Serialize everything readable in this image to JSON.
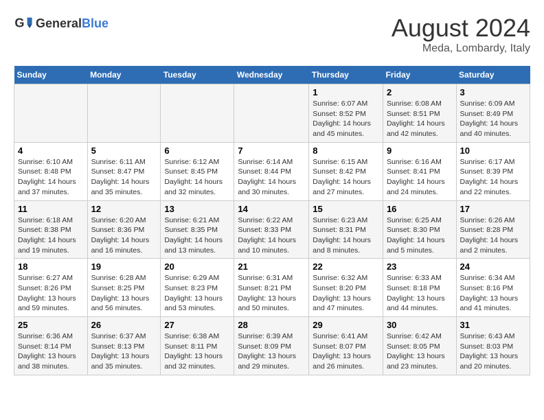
{
  "header": {
    "logo_general": "General",
    "logo_blue": "Blue",
    "main_title": "August 2024",
    "subtitle": "Meda, Lombardy, Italy"
  },
  "weekdays": [
    "Sunday",
    "Monday",
    "Tuesday",
    "Wednesday",
    "Thursday",
    "Friday",
    "Saturday"
  ],
  "weeks": [
    [
      {
        "day": "",
        "info": ""
      },
      {
        "day": "",
        "info": ""
      },
      {
        "day": "",
        "info": ""
      },
      {
        "day": "",
        "info": ""
      },
      {
        "day": "1",
        "info": "Sunrise: 6:07 AM\nSunset: 8:52 PM\nDaylight: 14 hours and 45 minutes."
      },
      {
        "day": "2",
        "info": "Sunrise: 6:08 AM\nSunset: 8:51 PM\nDaylight: 14 hours and 42 minutes."
      },
      {
        "day": "3",
        "info": "Sunrise: 6:09 AM\nSunset: 8:49 PM\nDaylight: 14 hours and 40 minutes."
      }
    ],
    [
      {
        "day": "4",
        "info": "Sunrise: 6:10 AM\nSunset: 8:48 PM\nDaylight: 14 hours and 37 minutes."
      },
      {
        "day": "5",
        "info": "Sunrise: 6:11 AM\nSunset: 8:47 PM\nDaylight: 14 hours and 35 minutes."
      },
      {
        "day": "6",
        "info": "Sunrise: 6:12 AM\nSunset: 8:45 PM\nDaylight: 14 hours and 32 minutes."
      },
      {
        "day": "7",
        "info": "Sunrise: 6:14 AM\nSunset: 8:44 PM\nDaylight: 14 hours and 30 minutes."
      },
      {
        "day": "8",
        "info": "Sunrise: 6:15 AM\nSunset: 8:42 PM\nDaylight: 14 hours and 27 minutes."
      },
      {
        "day": "9",
        "info": "Sunrise: 6:16 AM\nSunset: 8:41 PM\nDaylight: 14 hours and 24 minutes."
      },
      {
        "day": "10",
        "info": "Sunrise: 6:17 AM\nSunset: 8:39 PM\nDaylight: 14 hours and 22 minutes."
      }
    ],
    [
      {
        "day": "11",
        "info": "Sunrise: 6:18 AM\nSunset: 8:38 PM\nDaylight: 14 hours and 19 minutes."
      },
      {
        "day": "12",
        "info": "Sunrise: 6:20 AM\nSunset: 8:36 PM\nDaylight: 14 hours and 16 minutes."
      },
      {
        "day": "13",
        "info": "Sunrise: 6:21 AM\nSunset: 8:35 PM\nDaylight: 14 hours and 13 minutes."
      },
      {
        "day": "14",
        "info": "Sunrise: 6:22 AM\nSunset: 8:33 PM\nDaylight: 14 hours and 10 minutes."
      },
      {
        "day": "15",
        "info": "Sunrise: 6:23 AM\nSunset: 8:31 PM\nDaylight: 14 hours and 8 minutes."
      },
      {
        "day": "16",
        "info": "Sunrise: 6:25 AM\nSunset: 8:30 PM\nDaylight: 14 hours and 5 minutes."
      },
      {
        "day": "17",
        "info": "Sunrise: 6:26 AM\nSunset: 8:28 PM\nDaylight: 14 hours and 2 minutes."
      }
    ],
    [
      {
        "day": "18",
        "info": "Sunrise: 6:27 AM\nSunset: 8:26 PM\nDaylight: 13 hours and 59 minutes."
      },
      {
        "day": "19",
        "info": "Sunrise: 6:28 AM\nSunset: 8:25 PM\nDaylight: 13 hours and 56 minutes."
      },
      {
        "day": "20",
        "info": "Sunrise: 6:29 AM\nSunset: 8:23 PM\nDaylight: 13 hours and 53 minutes."
      },
      {
        "day": "21",
        "info": "Sunrise: 6:31 AM\nSunset: 8:21 PM\nDaylight: 13 hours and 50 minutes."
      },
      {
        "day": "22",
        "info": "Sunrise: 6:32 AM\nSunset: 8:20 PM\nDaylight: 13 hours and 47 minutes."
      },
      {
        "day": "23",
        "info": "Sunrise: 6:33 AM\nSunset: 8:18 PM\nDaylight: 13 hours and 44 minutes."
      },
      {
        "day": "24",
        "info": "Sunrise: 6:34 AM\nSunset: 8:16 PM\nDaylight: 13 hours and 41 minutes."
      }
    ],
    [
      {
        "day": "25",
        "info": "Sunrise: 6:36 AM\nSunset: 8:14 PM\nDaylight: 13 hours and 38 minutes."
      },
      {
        "day": "26",
        "info": "Sunrise: 6:37 AM\nSunset: 8:13 PM\nDaylight: 13 hours and 35 minutes."
      },
      {
        "day": "27",
        "info": "Sunrise: 6:38 AM\nSunset: 8:11 PM\nDaylight: 13 hours and 32 minutes."
      },
      {
        "day": "28",
        "info": "Sunrise: 6:39 AM\nSunset: 8:09 PM\nDaylight: 13 hours and 29 minutes."
      },
      {
        "day": "29",
        "info": "Sunrise: 6:41 AM\nSunset: 8:07 PM\nDaylight: 13 hours and 26 minutes."
      },
      {
        "day": "30",
        "info": "Sunrise: 6:42 AM\nSunset: 8:05 PM\nDaylight: 13 hours and 23 minutes."
      },
      {
        "day": "31",
        "info": "Sunrise: 6:43 AM\nSunset: 8:03 PM\nDaylight: 13 hours and 20 minutes."
      }
    ]
  ]
}
